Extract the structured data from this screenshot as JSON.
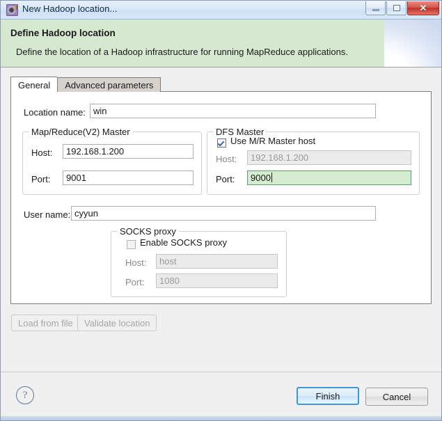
{
  "window": {
    "title": "New Hadoop location...",
    "icon": "hadoop-gear-icon",
    "minimize_label": "",
    "maximize_label": "",
    "close_label": "✕"
  },
  "banner": {
    "title": "Define Hadoop location",
    "description": "Define the location of a Hadoop infrastructure for running MapReduce applications."
  },
  "tabs": [
    {
      "label": "General",
      "active": true
    },
    {
      "label": "Advanced parameters",
      "active": false
    }
  ],
  "form": {
    "location_name_label": "Location name:",
    "location_name_value": "win",
    "user_name_label": "User name:",
    "user_name_value": "cyyun"
  },
  "mr_master": {
    "title": "Map/Reduce(V2) Master",
    "host_label": "Host:",
    "host_value": "192.168.1.200",
    "port_label": "Port:",
    "port_value": "9001"
  },
  "dfs_master": {
    "title": "DFS Master",
    "use_mr_host_label": "Use M/R Master host",
    "use_mr_host_checked": true,
    "host_label": "Host:",
    "host_value": "192.168.1.200",
    "port_label": "Port:",
    "port_value": "9000"
  },
  "socks_proxy": {
    "title": "SOCKS proxy",
    "enable_label": "Enable SOCKS proxy",
    "enable_checked": false,
    "host_label": "Host:",
    "host_placeholder": "host",
    "port_label": "Port:",
    "port_placeholder": "1080"
  },
  "actions": {
    "load_from_file": "Load from file",
    "validate_location": "Validate location"
  },
  "footer": {
    "help_label": "?",
    "finish_label": "Finish",
    "cancel_label": "Cancel"
  },
  "colors": {
    "banner_green": "#d5e8d0",
    "focus_field_green": "#d5ecd0",
    "accent_blue": "#3c97d4",
    "close_red": "#bc3127"
  }
}
